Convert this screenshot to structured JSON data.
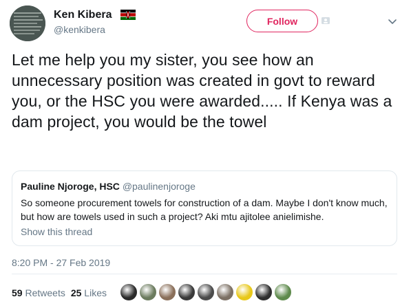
{
  "author": {
    "name": "Ken Kibera",
    "handle": "@kenkibera",
    "flag_icon": "kenya-flag-icon"
  },
  "follow_button": {
    "label": "Follow",
    "color": "#e0245e"
  },
  "tweet": {
    "text": "Let me help you my sister, you see how an unnecessary position was created in govt to reward you, or the HSC you were awarded..... If Kenya was a dam project, you would be the towel",
    "timestamp": "8:20 PM - 27 Feb 2019"
  },
  "quoted_tweet": {
    "name": "Pauline Njoroge, HSC",
    "handle": "@paulinenjoroge",
    "text": "So someone procurement towels for construction of a dam. Maybe I don't know much, but how are towels used in such a project? Aki mtu ajitolee anielimishe.",
    "link": "Show this thread"
  },
  "stats": {
    "retweets_count": "59",
    "retweets_label": "Retweets",
    "likes_count": "25",
    "likes_label": "Likes"
  },
  "likers": [
    {
      "name": "liker-avatar",
      "color": "#2a2a2a"
    },
    {
      "name": "liker-avatar",
      "color": "#6b7b5e"
    },
    {
      "name": "liker-avatar",
      "color": "#8a6f5a"
    },
    {
      "name": "liker-avatar",
      "color": "#3a3a3a"
    },
    {
      "name": "liker-avatar",
      "color": "#4b4b4b"
    },
    {
      "name": "liker-avatar",
      "color": "#7c7064"
    },
    {
      "name": "liker-avatar",
      "color": "#e8c81a"
    },
    {
      "name": "liker-avatar",
      "color": "#2e2e2e"
    },
    {
      "name": "liker-avatar",
      "color": "#5e8a4c"
    }
  ]
}
